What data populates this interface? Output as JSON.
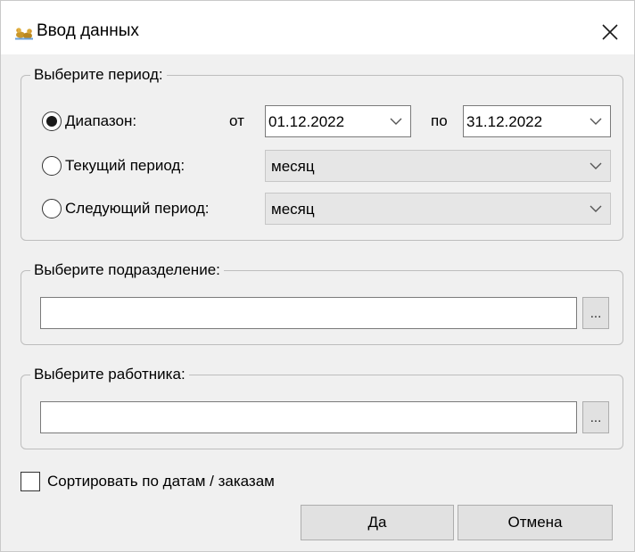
{
  "window": {
    "title": "Ввод данных",
    "icon": "ducks-app-icon",
    "close_icon": "close-icon"
  },
  "period": {
    "legend": "Выберите период:",
    "range": {
      "label": "Диапазон:",
      "selected": true,
      "from_label": "от",
      "from_value": "01.12.2022",
      "to_label": "по",
      "to_value": "31.12.2022"
    },
    "current": {
      "label": "Текущий период:",
      "selected": false,
      "value": "месяц"
    },
    "next": {
      "label": "Следующий период:",
      "selected": false,
      "value": "месяц"
    }
  },
  "department": {
    "legend": "Выберите подразделение:",
    "value": "",
    "browse_label": "..."
  },
  "employee": {
    "legend": "Выберите работника:",
    "value": "",
    "browse_label": "..."
  },
  "options": {
    "sort_label": "Сортировать по датам / заказам",
    "sort_checked": false
  },
  "buttons": {
    "ok": "Да",
    "cancel": "Отмена"
  }
}
